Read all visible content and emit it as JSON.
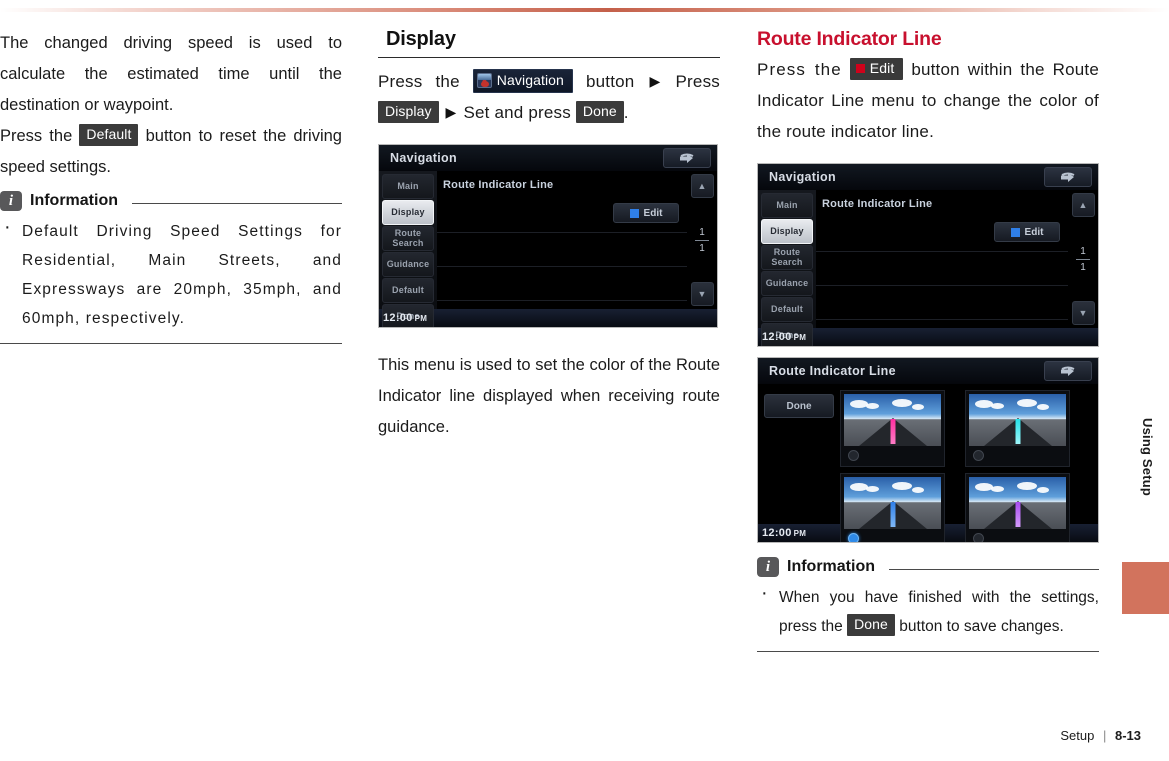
{
  "page": {
    "footer_section": "Setup",
    "footer_separator": "|",
    "footer_page": "8-13",
    "side_tab_label": "Using Setup",
    "side_tab_color": "#d2735d",
    "accent_color": "#c8102e"
  },
  "column1": {
    "paragraph1": "The changed driving speed is used to calculate the estimated time until the destination or waypoint.",
    "paragraph2_before": "Press the",
    "paragraph2_chip": "Default",
    "paragraph2_after": "button to reset the driving speed settings.",
    "information": {
      "badge": "i",
      "title": "Information",
      "items": [
        "Default Driving Speed Settings for Residential, Main Streets, and Expressways are 20mph, 35mph, and 60mph, respectively."
      ]
    }
  },
  "column2": {
    "section_title": "Display",
    "path_text": {
      "press_the": "Press the",
      "nav_chip": "Navigation",
      "nav_icon": "navigation-globe-icon",
      "button_word": "button",
      "arrow": "▶",
      "press_word": "Press",
      "display_chip": "Display",
      "set_and_press": "Set and press",
      "done_chip": "Done",
      "period": "."
    },
    "screenshot": {
      "title": "Navigation",
      "back_icon": "back-arrow-icon",
      "sidebar": [
        "Main",
        "Display",
        "Route\nSearch",
        "Guidance",
        "Default",
        "Done"
      ],
      "sidebar_active": "Display",
      "list_title": "Route Indicator Line",
      "edit_button": "Edit",
      "edit_swatch_color": "#2f7fe8",
      "page_indicator_top": "1",
      "page_indicator_bottom": "1",
      "scroll_up_icon": "chevron-up-icon",
      "scroll_down_icon": "chevron-down-icon",
      "clock": "12:00",
      "clock_ampm": "PM"
    },
    "paragraph_below": "This menu is used to set the color of the Route Indicator line displayed when receiving route guidance."
  },
  "column3": {
    "heading": "Route Indicator Line",
    "body_before": "Press the",
    "edit_chip": "Edit",
    "edit_chip_swatch": "#d0021b",
    "body_after": "button within the Route Indicator Line menu to change the color of the route indicator line.",
    "screenshot1": {
      "title": "Navigation",
      "back_icon": "back-arrow-icon",
      "sidebar": [
        "Main",
        "Display",
        "Route\nSearch",
        "Guidance",
        "Default",
        "Done"
      ],
      "sidebar_active": "Display",
      "list_title": "Route Indicator Line",
      "edit_button": "Edit",
      "edit_swatch_color": "#2f7fe8",
      "page_indicator_top": "1",
      "page_indicator_bottom": "1",
      "clock": "12:00",
      "clock_ampm": "PM"
    },
    "screenshot2": {
      "title": "Route Indicator Line",
      "back_icon": "back-arrow-icon",
      "done_button": "Done",
      "swatches": [
        {
          "name": "magenta",
          "color": "#ff2fa0",
          "selected": false
        },
        {
          "name": "cyan",
          "color": "#23e0e8",
          "selected": false
        },
        {
          "name": "blue",
          "color": "#2f7fe8",
          "selected": true
        },
        {
          "name": "purple",
          "color": "#a84cf0",
          "selected": false
        }
      ],
      "clock": "12:00",
      "clock_ampm": "PM"
    },
    "information": {
      "badge": "i",
      "title": "Information",
      "item_before": "When you have finished with the settings, press the",
      "item_chip": "Done",
      "item_after": "button to save changes."
    }
  }
}
